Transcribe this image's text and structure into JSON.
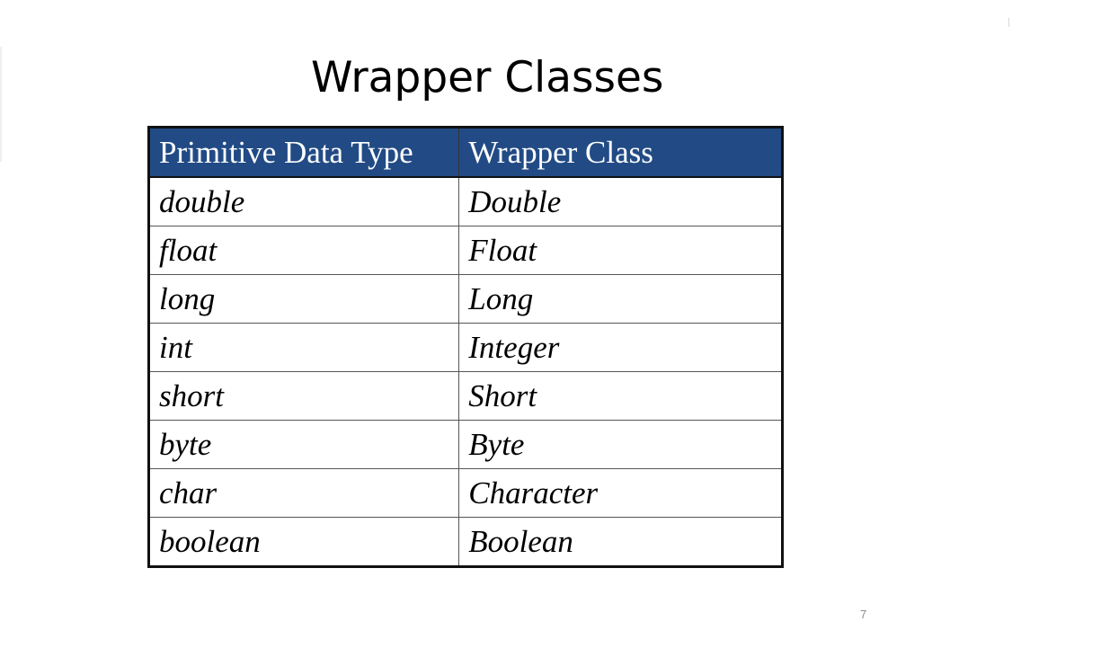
{
  "slide": {
    "title": "Wrapper Classes",
    "page_number": "7"
  },
  "table": {
    "headers": {
      "primitive": "Primitive Data Type",
      "wrapper": "Wrapper Class"
    },
    "rows": [
      {
        "primitive": "double",
        "wrapper": "Double"
      },
      {
        "primitive": "float",
        "wrapper": "Float"
      },
      {
        "primitive": "long",
        "wrapper": "Long"
      },
      {
        "primitive": "int",
        "wrapper": "Integer"
      },
      {
        "primitive": "short",
        "wrapper": "Short"
      },
      {
        "primitive": "byte",
        "wrapper": "Byte"
      },
      {
        "primitive": "char",
        "wrapper": "Character"
      },
      {
        "primitive": "boolean",
        "wrapper": "Boolean"
      }
    ],
    "colors": {
      "header_background": "#224b85",
      "header_text": "#ffffff",
      "border": "#111111"
    }
  }
}
